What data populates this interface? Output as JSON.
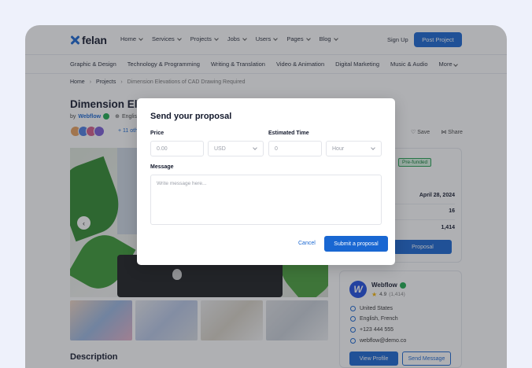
{
  "header": {
    "logo": "felan",
    "menu": [
      "Home",
      "Services",
      "Projects",
      "Jobs",
      "Users",
      "Pages",
      "Blog"
    ],
    "signup": "Sign Up",
    "post_project": "Post Project"
  },
  "categories": [
    "Graphic & Design",
    "Technology & Programming",
    "Writing & Translation",
    "Video & Animation",
    "Digital Marketing",
    "Music & Audio",
    "More"
  ],
  "breadcrumb": [
    "Home",
    "Projects",
    "Dimension Elevations of CAD Drawing Required"
  ],
  "project": {
    "title_visible": "Dimension Elev",
    "by": "by",
    "company": "Webflow",
    "language": "Englist",
    "others": "+ 11 othe",
    "save": "Save",
    "share": "Share"
  },
  "sidebar": {
    "badge": "Pre-funded",
    "date": "April 28, 2024",
    "count": "16",
    "amount": "1,414",
    "proposal_btn": "Proposal"
  },
  "company_card": {
    "name": "Webflow",
    "rating": "4.9",
    "rating_count": "(1,414)",
    "location": "United States",
    "languages": "English, French",
    "phone": "+123 444 555",
    "email": "webflow@demo.co",
    "view_profile": "View Profile",
    "send_message": "Send Message"
  },
  "description_heading": "Description",
  "modal": {
    "title": "Send your proposal",
    "price_label": "Price",
    "price_placeholder": "0.00",
    "currency": "USD",
    "time_label": "Estimated Time",
    "time_placeholder": "0",
    "time_unit": "Hour",
    "message_label": "Message",
    "message_placeholder": "Write message here...",
    "cancel": "Cancel",
    "submit": "Submit a proposal"
  },
  "colors": {
    "accent": "#1967d2",
    "background": "#eef1fb",
    "success": "#1dab4e"
  }
}
